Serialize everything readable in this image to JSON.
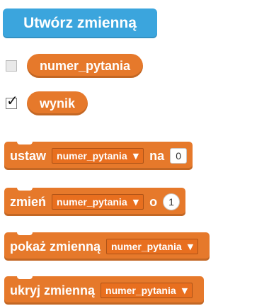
{
  "palette": {
    "make_button_bg": "#3ba5dd",
    "variable_block_orange": "#e6792b",
    "background": "#ffffff"
  },
  "make_variable_button": {
    "label": "Utwórz zmienną"
  },
  "variables": [
    {
      "name": "numer_pytania",
      "checked": false
    },
    {
      "name": "wynik",
      "checked": true
    }
  ],
  "blocks": {
    "set": {
      "keyword": "ustaw",
      "dropdown": "numer_pytania",
      "connector": "na",
      "value": "0"
    },
    "change": {
      "keyword": "zmień",
      "dropdown": "numer_pytania",
      "connector": "o",
      "value": "1"
    },
    "show": {
      "keyword": "pokaż zmienną",
      "dropdown": "numer_pytania"
    },
    "hide": {
      "keyword": "ukryj zmienną",
      "dropdown": "numer_pytania"
    }
  },
  "icons": {
    "checkbox_checked": "check-icon",
    "dropdown_arrow": "chevron-down-icon"
  }
}
